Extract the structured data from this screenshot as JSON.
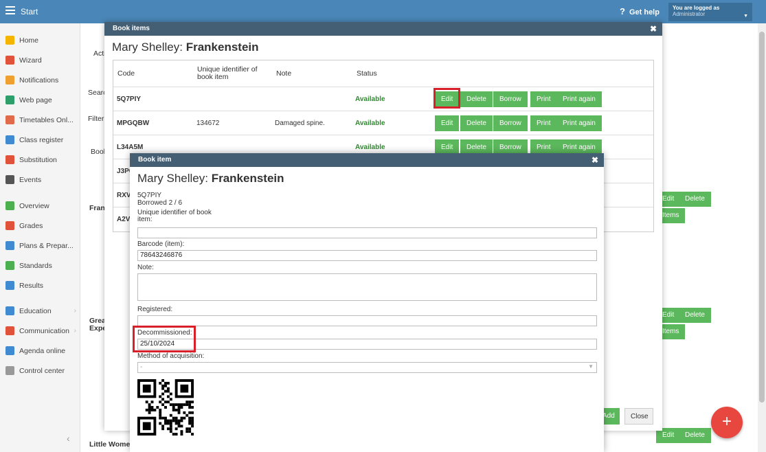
{
  "topbar": {
    "start": "Start",
    "help": "Get help",
    "user_line1": "You are logged as",
    "user_line2": "Administrator"
  },
  "sidebar": {
    "items": [
      {
        "label": "Home",
        "color": "#f4b400"
      },
      {
        "label": "Wizard",
        "color": "#e0533a"
      },
      {
        "label": "Notifications",
        "color": "#f0a030"
      },
      {
        "label": "Web page",
        "color": "#2e9f6b"
      },
      {
        "label": "Timetables Onl...",
        "color": "#e06a4a"
      },
      {
        "label": "Class register",
        "color": "#3f8ad0"
      },
      {
        "label": "Substitution",
        "color": "#e0533a"
      },
      {
        "label": "Events",
        "color": "#555555"
      },
      {
        "label": "Overview",
        "color": "#4caf50"
      },
      {
        "label": "Grades",
        "color": "#e0533a"
      },
      {
        "label": "Plans & Prepar...",
        "color": "#3f8ad0"
      },
      {
        "label": "Standards",
        "color": "#4caf50"
      },
      {
        "label": "Results",
        "color": "#3f8ad0"
      },
      {
        "label": "Education",
        "color": "#3f8ad0"
      },
      {
        "label": "Communication",
        "color": "#e0533a"
      },
      {
        "label": "Agenda online",
        "color": "#3f8ad0"
      },
      {
        "label": "Control center",
        "color": "#999999"
      }
    ]
  },
  "background": {
    "act": "Acti",
    "search": "Searc",
    "filter": "Filter",
    "book": "Bool",
    "fran": "Fran",
    "great1": "Grea",
    "great2": "Expe",
    "little": "Little Women",
    "edit": "Edit",
    "delete": "Delete",
    "items": "Items"
  },
  "book_items_modal": {
    "header": "Book items",
    "author": "Mary Shelley:",
    "title": "Frankenstein",
    "columns": {
      "code": "Code",
      "uid": "Unique identifier of book item",
      "note": "Note",
      "status": "Status"
    },
    "rows": [
      {
        "code": "5Q7PIY",
        "uid": "",
        "note": "",
        "status": "Available"
      },
      {
        "code": "MPGQBW",
        "uid": "134672",
        "note": "Damaged spine.",
        "status": "Available"
      },
      {
        "code": "L34A5M",
        "uid": "",
        "note": "",
        "status": "Available"
      },
      {
        "code": "J3PC",
        "uid": "",
        "note": "",
        "status": ""
      },
      {
        "code": "RXV",
        "uid": "",
        "note": "",
        "status": ""
      },
      {
        "code": "A2V4",
        "uid": "",
        "note": "",
        "status": ""
      }
    ],
    "actions": {
      "edit": "Edit",
      "delete": "Delete",
      "borrow": "Borrow",
      "print": "Print",
      "print_again": "Print again"
    },
    "footer": {
      "add": "Add",
      "close": "Close"
    }
  },
  "book_item_modal": {
    "header": "Book item",
    "author": "Mary Shelley:",
    "title": "Frankenstein",
    "code": "5Q7PIY",
    "borrowed": "Borrowed 2 / 6",
    "uid_label": "Unique identifier of book item:",
    "uid_value": "",
    "barcode_label": "Barcode (item):",
    "barcode_value": "78643246876",
    "note_label": "Note:",
    "note_value": "",
    "registered_label": "Registered:",
    "registered_value": "",
    "decommissioned_label": "Decommissioned:",
    "decommissioned_value": "25/10/2024",
    "acquisition_label": "Method of acquisition:",
    "acquisition_value": "-"
  }
}
